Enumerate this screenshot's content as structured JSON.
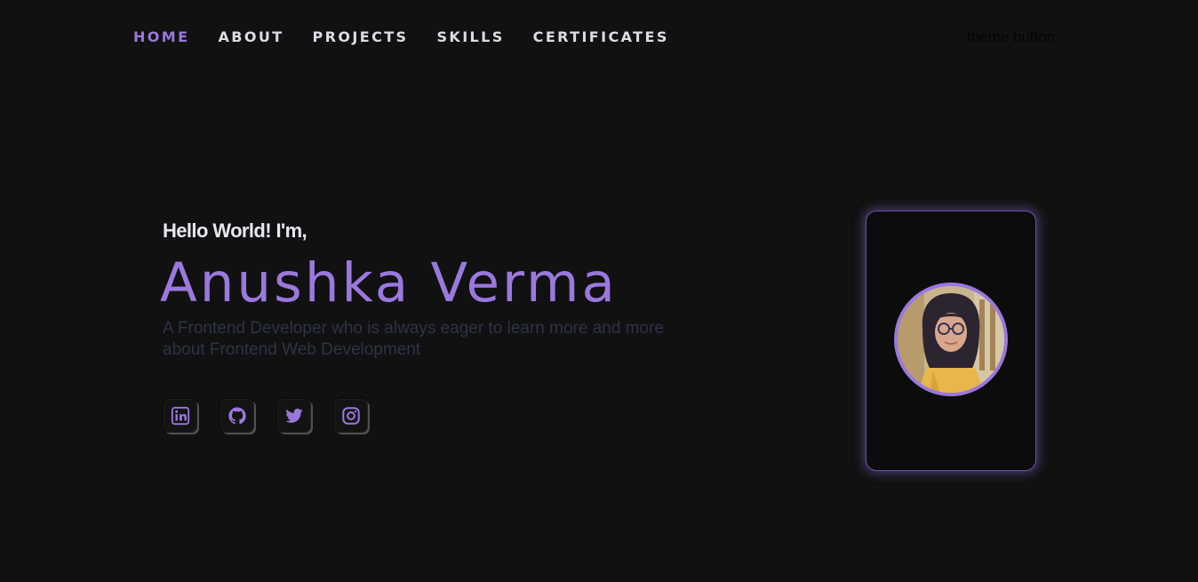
{
  "nav": {
    "items": [
      {
        "label": "HOME",
        "active": true
      },
      {
        "label": "ABOUT",
        "active": false
      },
      {
        "label": "PROJECTS",
        "active": false
      },
      {
        "label": "SKILLS",
        "active": false
      },
      {
        "label": "CERTIFICATES",
        "active": false
      }
    ],
    "theme_button_label": "theme button"
  },
  "hero": {
    "greeting": "Hello World! I'm,",
    "name": "Anushka Verma",
    "tagline": "A Frontend Developer who is always eager to learn more and more about Frontend Web Development"
  },
  "socials": [
    {
      "icon": "linkedin-icon"
    },
    {
      "icon": "github-icon"
    },
    {
      "icon": "twitter-icon"
    },
    {
      "icon": "instagram-icon"
    }
  ],
  "profile": {
    "avatar_icon": "profile-photo"
  },
  "colors": {
    "background": "#111111",
    "accent": "#9a78dd",
    "nav_text": "#dcdce6",
    "tagline_text": "#2d3346"
  }
}
